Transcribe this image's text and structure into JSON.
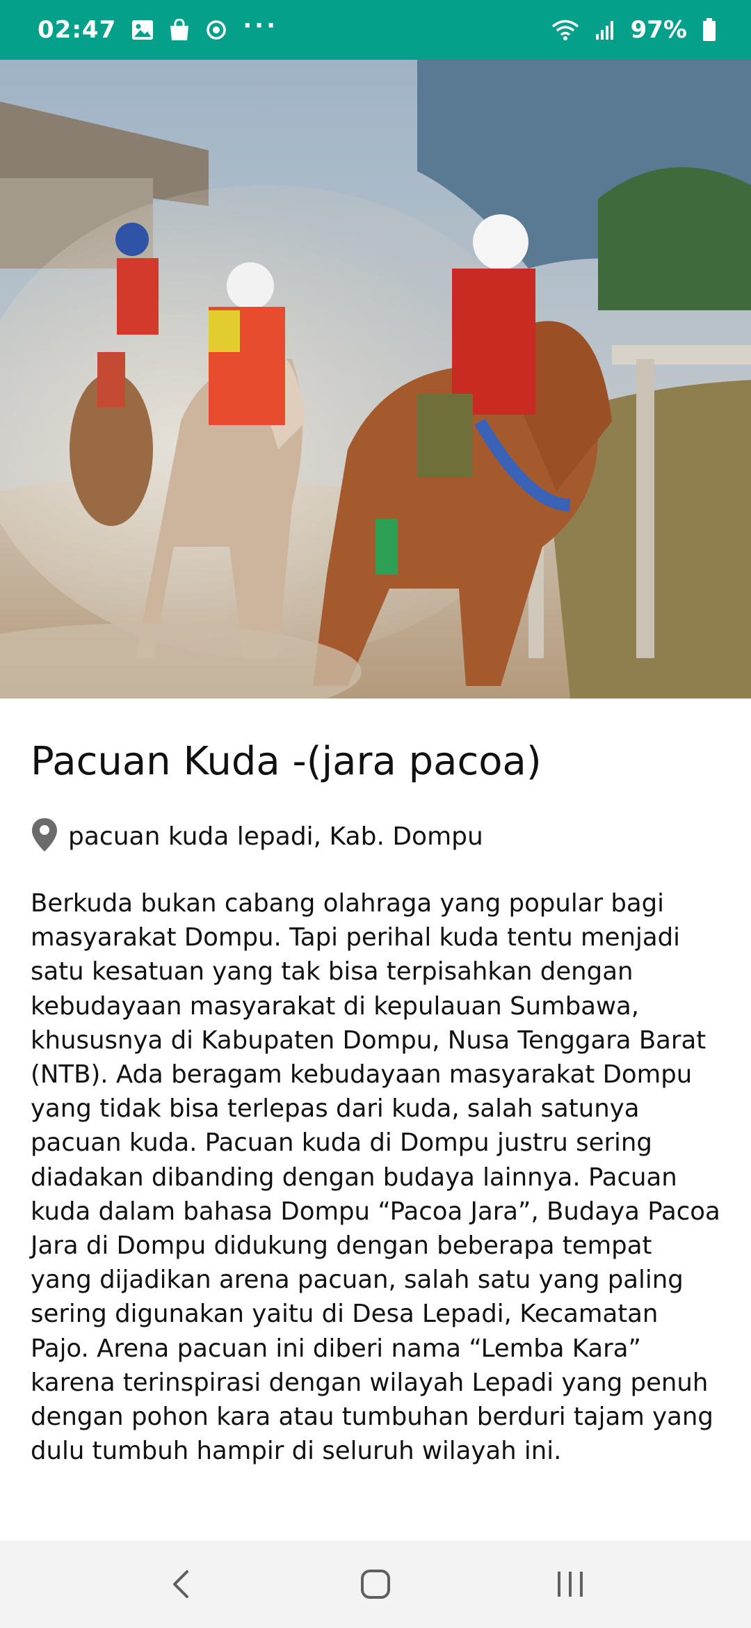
{
  "status_bar": {
    "time": "02:47",
    "battery": "97%",
    "overflow": "···",
    "icons": [
      "gallery-icon",
      "shopping-bag-icon",
      "sync-icon",
      "wifi-icon",
      "signal-icon",
      "battery-icon"
    ],
    "bg_color": "#05a08a"
  },
  "hero": {
    "icon": "horse-racing-photo"
  },
  "place": {
    "title": "Pacuan Kuda -(jara pacoa)",
    "location": "pacuan kuda lepadi, Kab. Dompu",
    "description": "Berkuda bukan cabang olahraga yang popular bagi masyarakat Dompu. Tapi perihal kuda tentu menjadi satu kesatuan yang tak bisa terpisahkan dengan kebudayaan masyarakat di kepulauan Sumbawa, khususnya di Kabupaten Dompu, Nusa Tenggara Barat (NTB). Ada beragam kebudayaan masyarakat Dompu yang tidak bisa terlepas dari kuda, salah satunya pacuan kuda. Pacuan kuda di Dompu justru sering diadakan dibanding dengan budaya lainnya. Pacuan kuda dalam bahasa Dompu “Pacoa Jara”, Budaya Pacoa Jara di Dompu didukung dengan beberapa tempat yang dijadikan arena pacuan, salah satu yang paling sering digunakan yaitu di Desa Lepadi, Kecamatan Pajo. Arena pacuan ini diberi nama “Lemba Kara” karena terinspirasi dengan wilayah Lepadi yang penuh dengan pohon kara atau tumbuhan berduri tajam yang dulu tumbuh hampir di seluruh wilayah ini."
  },
  "nav_bar": {
    "buttons": [
      "back-icon",
      "home-icon",
      "recents-icon"
    ]
  }
}
